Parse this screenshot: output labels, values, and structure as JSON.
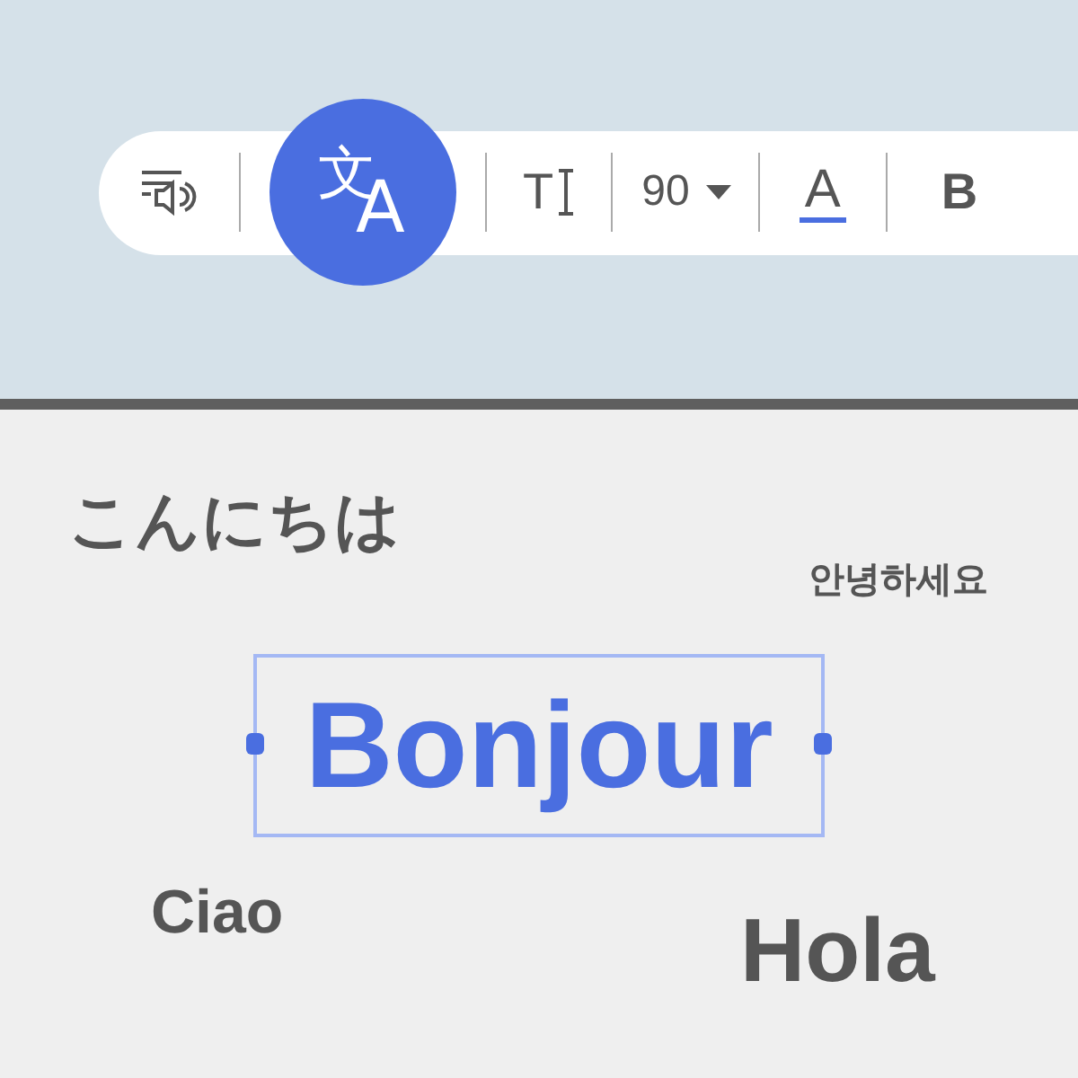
{
  "toolbar": {
    "items": [
      {
        "kind": "speak"
      },
      {
        "kind": "translate",
        "glyphs": [
          "文",
          "A"
        ],
        "selected": true
      },
      {
        "kind": "textstyle",
        "label": "T"
      },
      {
        "kind": "size",
        "label": "90"
      },
      {
        "kind": "color",
        "label": "A",
        "color": "#4a6ee0"
      },
      {
        "kind": "bold",
        "label": "B"
      }
    ]
  },
  "canvas": {
    "texts": [
      {
        "text": "こんにちは",
        "selected": false
      },
      {
        "text": "안녕하세요",
        "selected": false
      },
      {
        "text": "Bonjour",
        "selected": true
      },
      {
        "text": "Ciao",
        "selected": false
      },
      {
        "text": "Hola",
        "selected": false
      }
    ]
  }
}
